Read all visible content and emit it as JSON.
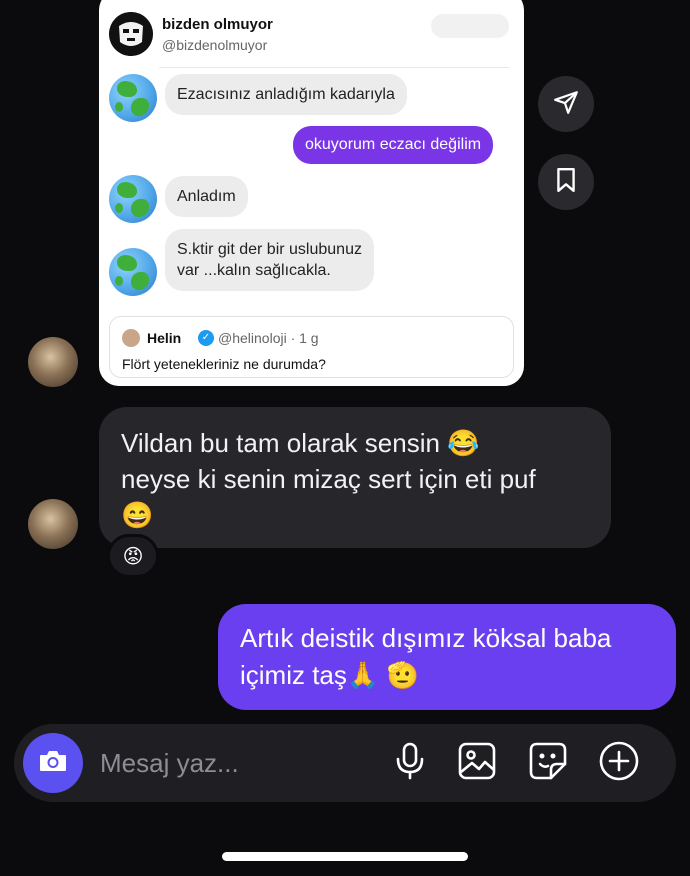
{
  "shared_post": {
    "author_name": "bizden olmuyor",
    "author_handle": "@bizdenolmuyor",
    "messages": [
      {
        "direction": "in",
        "text": "Ezacısınız anladığım kadarıyla"
      },
      {
        "direction": "out",
        "text": "okuyorum eczacı değilim"
      },
      {
        "direction": "in",
        "text": "Anladım"
      },
      {
        "direction": "in",
        "text": "S.ktir git der bir uslubunuz\nvar ...kalın sağlıcakla."
      }
    ],
    "quoted": {
      "name": "Helin",
      "handle_time": "@helinoloji · 1 g",
      "text": "Flört yetenekleriniz ne durumda?"
    }
  },
  "side_actions": {
    "share_icon": "paper-plane-icon",
    "save_icon": "bookmark-icon"
  },
  "chat": {
    "incoming_message": {
      "line1": "Vildan bu tam olarak sensin 😂",
      "line2": "neyse ki senin mizaç sert için eti puf",
      "line3": "😄"
    },
    "reaction": "😡",
    "outgoing_message": {
      "line1": "Artık deistik dışımız köksal baba",
      "line2": "içimiz taş🙏 🫡"
    }
  },
  "composer": {
    "placeholder": "Mesaj yaz...",
    "icons": [
      "camera-icon",
      "microphone-icon",
      "image-icon",
      "sticker-icon",
      "plus-icon"
    ]
  },
  "colors": {
    "background": "#0b0b0d",
    "incoming_bubble": "#26262b",
    "outgoing_bubble": "#6a3ff0",
    "post_outgoing_bubble": "#7a35e6",
    "camera_button": "#5b50f0"
  }
}
